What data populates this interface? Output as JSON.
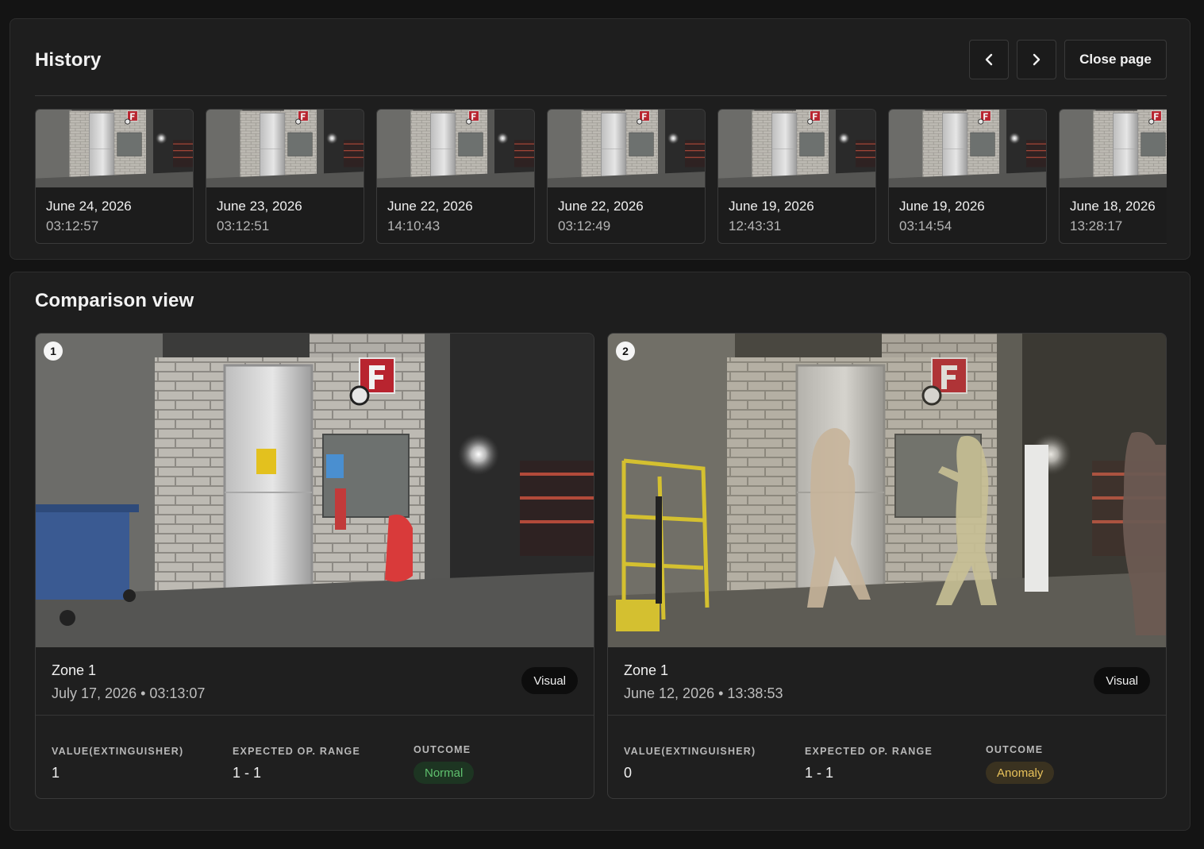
{
  "history": {
    "title": "History",
    "prev_icon": "chevron-left-icon",
    "next_icon": "chevron-right-icon",
    "close_label": "Close page",
    "items": [
      {
        "date": "June 24, 2026",
        "time": "03:12:57"
      },
      {
        "date": "June 23, 2026",
        "time": "03:12:51"
      },
      {
        "date": "June 22, 2026",
        "time": "14:10:43"
      },
      {
        "date": "June 22, 2026",
        "time": "03:12:49"
      },
      {
        "date": "June 19, 2026",
        "time": "12:43:31"
      },
      {
        "date": "June 19, 2026",
        "time": "03:14:54"
      },
      {
        "date": "June 18, 2026",
        "time": "13:28:17"
      }
    ]
  },
  "comparison": {
    "title": "Comparison view",
    "cards": [
      {
        "index": "1",
        "zone": "Zone 1",
        "datetime": "July 17, 2026 • 03:13:07",
        "mode": "Visual",
        "metrics": {
          "value_label": "VALUE(EXTINGUISHER)",
          "value": "1",
          "range_label": "EXPECTED OP. RANGE",
          "range": "1 - 1",
          "outcome_label": "OUTCOME",
          "outcome": "Normal"
        }
      },
      {
        "index": "2",
        "zone": "Zone 1",
        "datetime": "June 12, 2026 • 13:38:53",
        "mode": "Visual",
        "metrics": {
          "value_label": "VALUE(EXTINGUISHER)",
          "value": "0",
          "range_label": "EXPECTED OP. RANGE",
          "range": "1 - 1",
          "outcome_label": "OUTCOME",
          "outcome": "Anomaly"
        }
      }
    ]
  },
  "colors": {
    "background": "#141414",
    "panel": "#1e1e1e",
    "normal_text": "#5fc06e",
    "anomaly_text": "#e8c25b",
    "sign_red": "#b8242f"
  },
  "scene_sign": "F"
}
